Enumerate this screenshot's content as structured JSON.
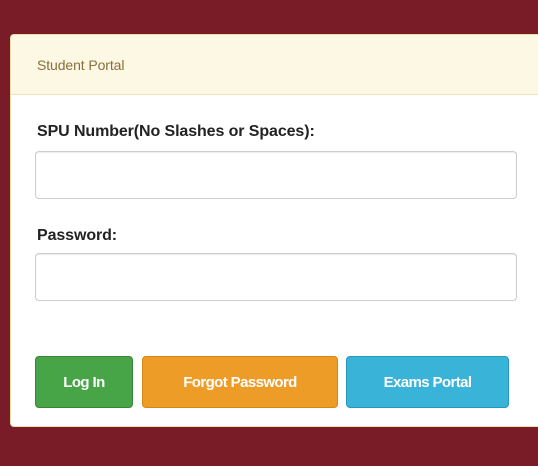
{
  "colors": {
    "page_background": "#7a1c27",
    "panel_heading_background": "#fcf8e3",
    "panel_heading_text": "#8a6d3b",
    "login_button": "#47a447",
    "forgot_button": "#ed9c28",
    "exams_button": "#39b3d7"
  },
  "panel": {
    "title": "Student Portal"
  },
  "form": {
    "spu_label": "SPU Number(No Slashes or Spaces):",
    "spu_value": "",
    "spu_placeholder": "",
    "password_label": "Password:",
    "password_value": "",
    "password_placeholder": ""
  },
  "buttons": {
    "login_label": "Log In",
    "forgot_label": "Forgot Password",
    "exams_label": "Exams Portal"
  }
}
